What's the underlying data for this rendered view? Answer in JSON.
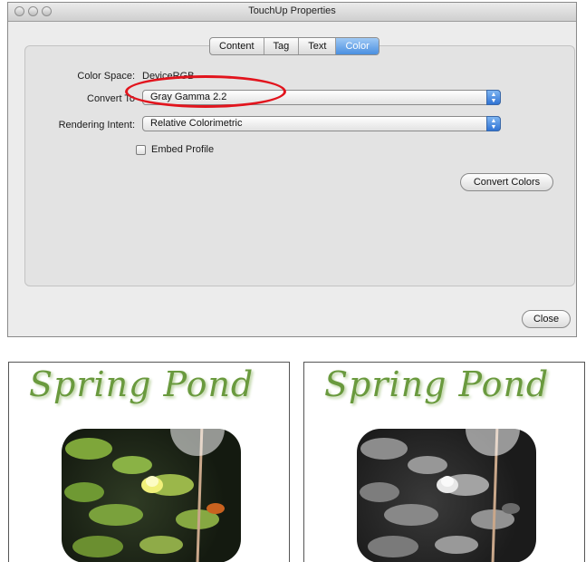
{
  "window": {
    "title": "TouchUp Properties",
    "tabs": [
      "Content",
      "Tag",
      "Text",
      "Color"
    ],
    "active_tab": "Color"
  },
  "color_tab": {
    "color_space_label": "Color Space:",
    "color_space_value": "DeviceRGB",
    "convert_to_label": "Convert To",
    "convert_to_value": "Gray Gamma 2.2",
    "rendering_intent_label": "Rendering Intent:",
    "rendering_intent_value": "Relative Colorimetric",
    "embed_profile_label": "Embed Profile",
    "embed_profile_checked": false,
    "convert_button": "Convert Colors"
  },
  "close_button": "Close",
  "annotation_color": "#e2141d",
  "samples": [
    {
      "title": "Spring Pond",
      "mode": "color",
      "title_color": "#6a9a3e"
    },
    {
      "title": "Spring Pond",
      "mode": "grayscale",
      "title_color": "#6a9a3e"
    }
  ]
}
